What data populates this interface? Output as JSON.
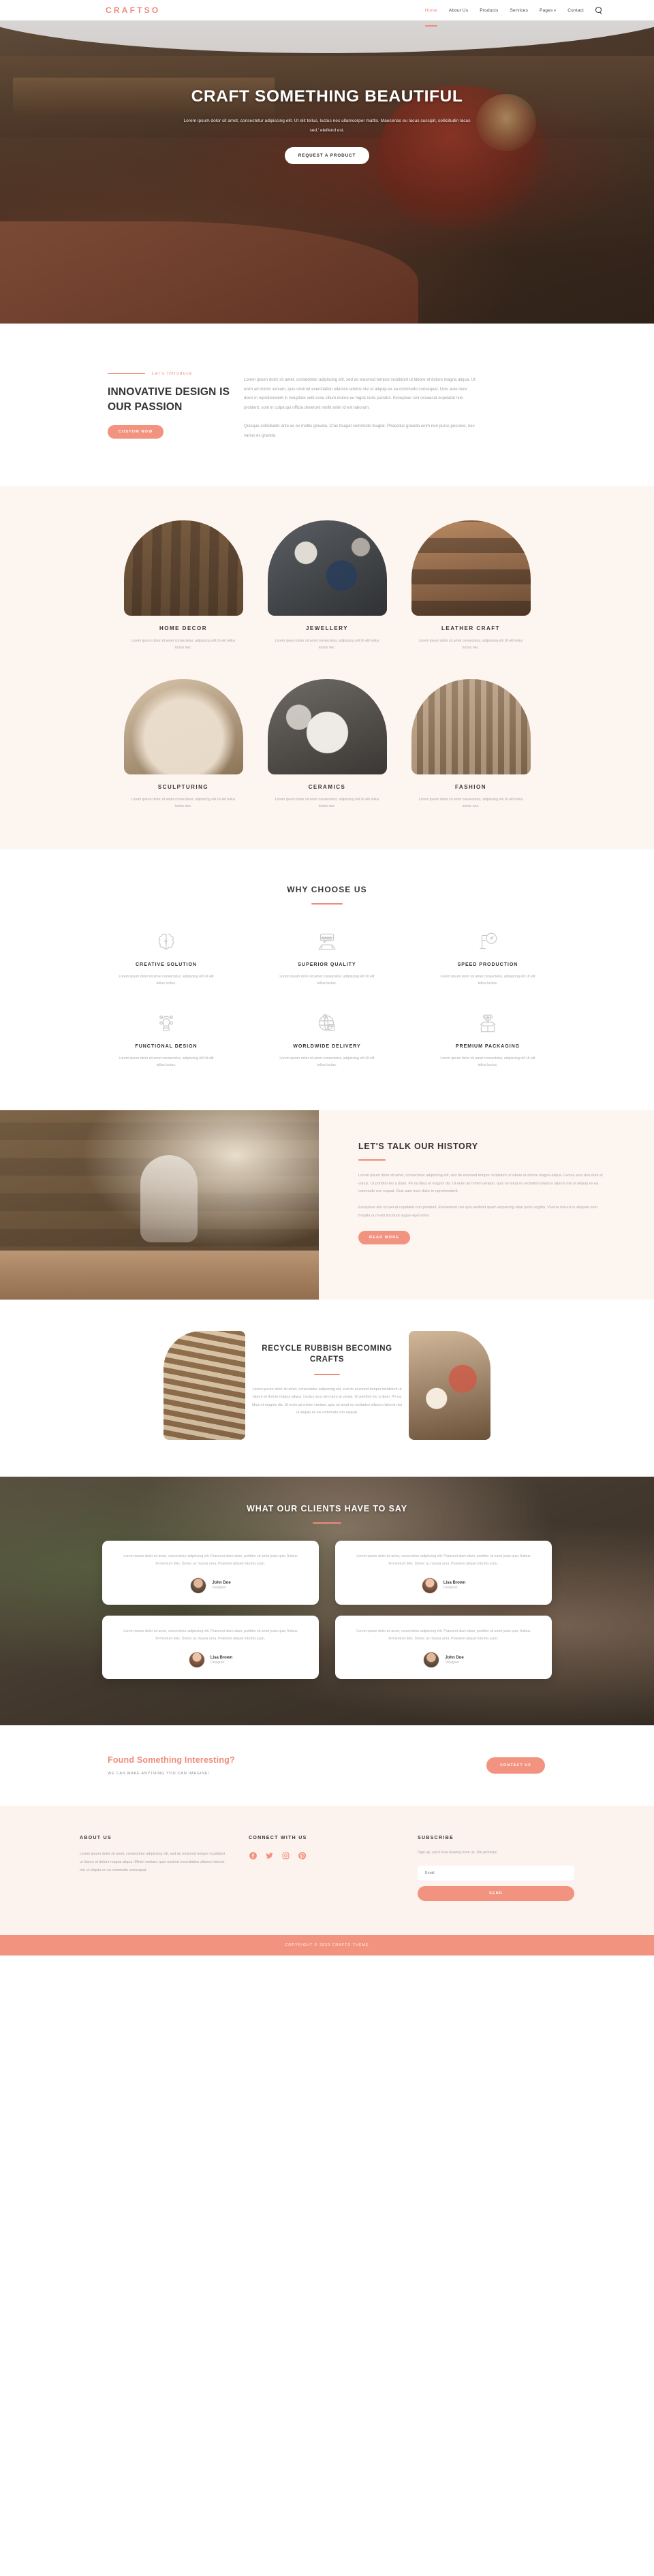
{
  "header": {
    "logo": "CRAFTSO",
    "nav": [
      {
        "label": "Home",
        "active": true
      },
      {
        "label": "About Us",
        "active": false
      },
      {
        "label": "Products",
        "active": false
      },
      {
        "label": "Services",
        "active": false
      },
      {
        "label": "Pages",
        "active": false,
        "caret": "▾"
      },
      {
        "label": "Contact",
        "active": false
      }
    ],
    "search_icon": "search-icon"
  },
  "hero": {
    "title": "CRAFT SOMETHING BEAUTIFUL",
    "subtitle": "Lorem ipsum dolor sit amet, consectetur adipiscing elit. Ut elit tellus, luctus nec ullamcorper mattis. Maecenas eu lacus suscipit, sollicitudin lacus sed,' eleifend est.",
    "button": "REQUEST A PRODUCT"
  },
  "intro": {
    "eyebrow": "Let's Introduce",
    "heading": "INNOVATIVE DESIGN IS OUR PASSION",
    "button": "CUSTOM NOW",
    "paragraph1": "Lorem ipsum dolor sit amet, consectetur adipiscing elit, sed do eiusmod tempor incididunt ut labore et dolore magna aliqua. Ut enim ad minim veniam, quis nostrud exercitation ullamco laboris nisi ut aliquip ex ea commodo consequat. Duis aute irure dolor in reprehenderit in voluptate velit esse cillum dolore eu fugiat nulla pariatur. Excepteur sint occaecat cupidatat non proident, sunt in culpa qui officia deserunt mollit anim id est laborum.",
    "paragraph2": "Quisque sollicitudin ante ac ex mattis gravida. Cras feugiat commodo feugiat. Phasellus gravida enim non purus posuere, nec varius ex gravida."
  },
  "categories": {
    "items": [
      {
        "title": "HOME DECOR",
        "desc": "Lorem ipsum dolor sit amet consectetur, adipiscing elit Ut elit tellus luctus nec."
      },
      {
        "title": "JEWELLERY",
        "desc": "Lorem ipsum dolor sit amet consectetur, adipiscing elit Ut elit tellus luctus nec."
      },
      {
        "title": "LEATHER CRAFT",
        "desc": "Lorem ipsum dolor sit amet consectetur, adipiscing elit Ut elit tellus luctus nec."
      },
      {
        "title": "SCULPTURING",
        "desc": "Lorem ipsum dolor sit amet consectetur, adipiscing elit Ut elit tellus luctus nec."
      },
      {
        "title": "CERAMICS",
        "desc": "Lorem ipsum dolor sit amet consectetur, adipiscing elit Ut elit tellus luctus nec."
      },
      {
        "title": "FASHION",
        "desc": "Lorem ipsum dolor sit amet consectetur, adipiscing elit Ut elit tellus luctus nec."
      }
    ]
  },
  "why": {
    "heading": "WHY CHOOSE US",
    "items": [
      {
        "title": "CREATIVE SOLUTION",
        "desc": "Lorem ipsum dolor sit amet consectetur, adipiscing elit Ut elit tellus luctus.",
        "icon": "brain-icon"
      },
      {
        "title": "SUPERIOR QUALITY",
        "desc": "Lorem ipsum dolor sit amet consectetur, adipiscing elit Ut elit tellus luctus.",
        "icon": "review-stars-icon"
      },
      {
        "title": "SPEED PRODUCTION",
        "desc": "Lorem ipsum dolor sit amet consectetur, adipiscing elit Ut elit tellus luctus.",
        "icon": "speed-gauge-icon"
      },
      {
        "title": "FUNCTIONAL DESIGN",
        "desc": "Lorem ipsum dolor sit amet consectetur, adipiscing elit Ut elit tellus luctus.",
        "icon": "pen-tool-icon"
      },
      {
        "title": "WORLDWIDE DELIVERY",
        "desc": "Lorem ipsum dolor sit amet consectetur, adipiscing elit Ut elit tellus luctus.",
        "icon": "globe-delivery-icon"
      },
      {
        "title": "PREMIUM PACKAGING",
        "desc": "Lorem ipsum dolor sit amet consectetur, adipiscing elit Ut elit tellus luctus.",
        "icon": "trophy-box-icon"
      }
    ]
  },
  "history": {
    "heading": "LET'S TALK OUR HISTORY",
    "paragraph1": "Lorem ipsum dolor sit amet, consectetur adipiscing elit, sed do eiusmod tempor incididunt ut labore et dolore magna aliqua. Lectus arcu ben dum at varius. Ut porttitor leo a diam. Pe na tibus et magnis dis. Ut enim ad minim veniam, quis no strud ex ercitation ullamco laboris nisi ut aliquip ex ea commodo con sequat. Duis aute irure dolor in reprehenderit.",
    "paragraph2": "Excepteur sint occaecat cupidatat non proident. Elementum nisi quis eleifend quam adipiscing vitae proin sagittis. Viverra mauris in aliquam sem fringilla ut morbi tincidunt augue eget dolor.",
    "button": "READ MORE"
  },
  "recycle": {
    "heading": "RECYCLE RUBBISH BECOMING CRAFTS",
    "paragraph": "Lorem ipsum dolor sit amet, consectetur adipiscing elit, sed do eiusmod tempor incididunt ut labore et dolore magna aliqua. Lectus arcu ben dum at varius. Ut porttitor leo a diam. Pe na tibus et magnis dis. Ut enim ad minim veniam, quis no strud ex ercitation ullamco laboris nisi ut aliquip ex ea commodo con sequat."
  },
  "testimonials": {
    "heading": "WHAT OUR CLIENTS HAVE TO SAY",
    "quote": "Lorem ipsum dolor sit amet, consectetur adipiscing elit. Praesent diam diam, porttitor sit amet justo quis, finibus fermentum felis. Donec ac massa urna. Praesent aliquet lobortis justo.",
    "items": [
      {
        "name": "John Doe",
        "role": "Designer",
        "avatar": "avatar-male"
      },
      {
        "name": "Lisa Brown",
        "role": "Designer",
        "avatar": "avatar-female"
      },
      {
        "name": "Lisa Brown",
        "role": "Designer",
        "avatar": "avatar-female"
      },
      {
        "name": "John Doe",
        "role": "Designer",
        "avatar": "avatar-male"
      }
    ]
  },
  "cta": {
    "heading": "Found Something Interesting?",
    "subheading": "WE CAN MAKE ANYTHING YOU CAN IMAGINE!",
    "button": "CONTACT US"
  },
  "footer": {
    "about_title": "ABOUT US",
    "about_text": "Lorem ipsum dolor sit amet, consectetur adipiscing elit, sed do eiusmod tempor incididunt ut labore et dolore magna aliqua. Minim veniam, quis nostrud exercitation ullamco laboris nisi ut aliquip ex ea commodo consequat.",
    "connect_title": "CONNECT WITH US",
    "socials": [
      "facebook-icon",
      "twitter-icon",
      "instagram-icon",
      "pinterest-icon"
    ],
    "subscribe_title": "SUBSCRIBE",
    "subscribe_text": "Sign up, you'll love hearing from us. We promise!",
    "email_placeholder": "Email",
    "send_button": "SEND",
    "copyright": "COPYRIGHT © 2020 CRAFTO THEME"
  },
  "colors": {
    "accent": "#ef8b7c",
    "accent_solid": "#f2937f",
    "cream": "#fdf5f0",
    "dark_text": "#333333"
  }
}
